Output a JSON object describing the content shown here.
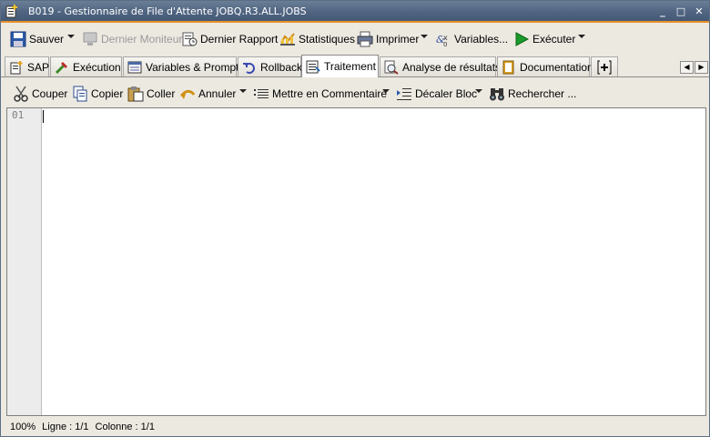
{
  "window": {
    "title": "B019 - Gestionnaire de File d'Attente JOBQ.R3.ALL.JOBS",
    "minimize": "_",
    "maximize": "□",
    "close": "✕"
  },
  "main_toolbar": {
    "save": "Sauver",
    "last_monitor": "Dernier Moniteur",
    "last_report": "Dernier Rapport",
    "statistics": "Statistiques",
    "print": "Imprimer",
    "variables": "Variables...",
    "execute": "Exécuter"
  },
  "tabs": [
    {
      "label": "SAP",
      "icon": "sap-icon"
    },
    {
      "label": "Exécution",
      "icon": "execution-icon"
    },
    {
      "label": "Variables & Prompts",
      "icon": "variables-icon"
    },
    {
      "label": "Rollback",
      "icon": "rollback-icon"
    },
    {
      "label": "Traitement",
      "icon": "processing-icon",
      "active": true
    },
    {
      "label": "Analyse de résultats",
      "icon": "analysis-icon"
    },
    {
      "label": "Documentation",
      "icon": "documentation-icon"
    }
  ],
  "edit_toolbar": {
    "cut": "Couper",
    "copy": "Copier",
    "paste": "Coller",
    "undo": "Annuler",
    "comment": "Mettre en Commentaire",
    "shift_block": "Décaler Bloc",
    "search": "Rechercher ..."
  },
  "editor": {
    "line_numbers": [
      "01"
    ],
    "content": ""
  },
  "status": {
    "zoom": "100%",
    "line": "Ligne : 1/1",
    "column": "Colonne : 1/1"
  },
  "colors": {
    "title_bar": "#4e6380",
    "title_accent": "#e8902a",
    "execute_green": "#1a9a2a"
  }
}
